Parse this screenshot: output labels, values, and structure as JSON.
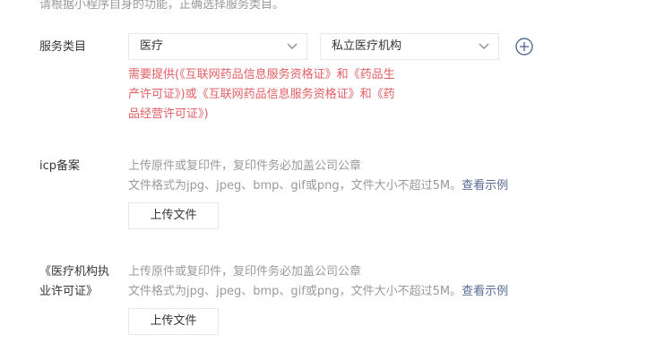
{
  "hint": "请根据小程序自身的功能，正确选择服务类目。",
  "service_category": {
    "label": "服务类目",
    "primary_value": "医疗",
    "secondary_value": "私立医疗机构",
    "add_icon": "plus-circle-icon",
    "warning": "需要提供(《互联网药品信息服务资格证》和《药品生产许可证》)或《互联网药品信息服务资格证》和《药品经营许可证》)"
  },
  "icp": {
    "label": "icp备案",
    "desc_line1": "上传原件或复印件，复印件务必加盖公司公章",
    "desc_line2": "文件格式为jpg、jpeg、bmp、gif或png，文件大小不超过5M。",
    "example_link": "查看示例",
    "upload_label": "上传文件"
  },
  "medical_license": {
    "label_line1": "《医疗机构执",
    "label_line2": "业许可证》",
    "desc_line1": "上传原件或复印件，复印件务必加盖公司公章",
    "desc_line2": "文件格式为jpg、jpeg、bmp、gif或png，文件大小不超过5M。",
    "example_link": "查看示例",
    "upload_label": "上传文件"
  },
  "colors": {
    "warning": "#e15f63",
    "link": "#576b95",
    "muted": "#9a9a9a",
    "border": "#e7e7eb"
  }
}
